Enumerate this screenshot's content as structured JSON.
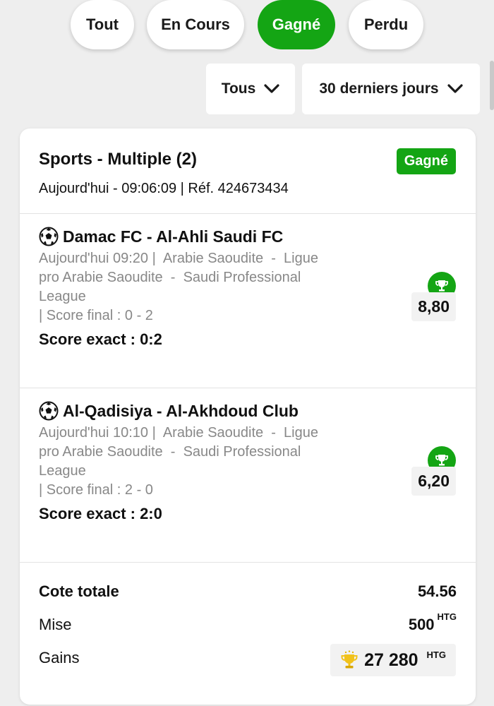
{
  "tabs": [
    {
      "label": "Tout",
      "active": false
    },
    {
      "label": "En Cours",
      "active": false
    },
    {
      "label": "Gagné",
      "active": true
    },
    {
      "label": "Perdu",
      "active": false
    }
  ],
  "filters": {
    "type_label": "Tous",
    "period_label": "30 derniers jours",
    "chevron_icon": "chevron-down-icon"
  },
  "colors": {
    "accent_green": "#14a514",
    "background": "#eeeeee",
    "muted_text": "#888888"
  },
  "bet": {
    "title": "Sports - Multiple (2)",
    "subtitle": "Aujourd'hui - 09:06:09 | Réf. 424673434",
    "status": "Gagné",
    "selections": [
      {
        "match": "Damac FC - Al-Ahli Saudi FC",
        "date": "Aujourd'hui 09:20 |",
        "country": "Arabie Saoudite",
        "competition_line1": "Ligue",
        "competition_line2": "pro Arabie Saoudite",
        "competition_line3": "Saudi Professional",
        "competition_line4": "League",
        "final_score": "| Score final : 0 - 2",
        "pick": "Score exact : 0:2",
        "odds": "8,80",
        "sport_icon": "soccer-ball-icon",
        "result_icon": "trophy-icon"
      },
      {
        "match": "Al-Qadisiya - Al-Akhdoud Club",
        "date": "Aujourd'hui 10:10 |",
        "country": "Arabie Saoudite",
        "competition_line1": "Ligue",
        "competition_line2": "pro Arabie Saoudite",
        "competition_line3": "Saudi Professional",
        "competition_line4": "League",
        "final_score": "| Score final : 2 - 0",
        "pick": "Score exact : 2:0",
        "odds": "6,20",
        "sport_icon": "soccer-ball-icon",
        "result_icon": "trophy-icon"
      }
    ],
    "summary": {
      "total_odds_label": "Cote totale",
      "total_odds": "54.56",
      "stake_label": "Mise",
      "stake": "500",
      "stake_currency": "HTG",
      "winnings_label": "Gains",
      "winnings": "27 280",
      "winnings_currency": "HTG"
    }
  }
}
